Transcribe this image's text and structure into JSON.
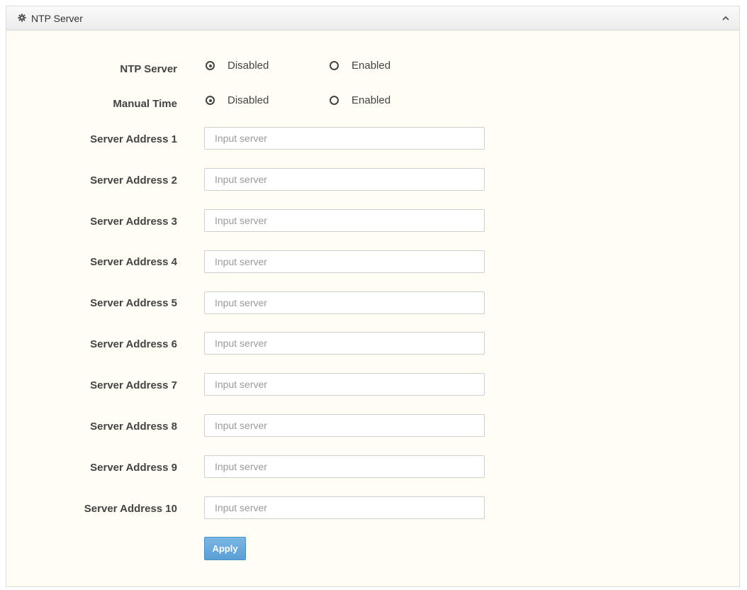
{
  "panel": {
    "title": "NTP Server",
    "header_icon": "gear-icon",
    "collapse_icon": "chevron-up-icon"
  },
  "ntp_server": {
    "label": "NTP Server",
    "options": [
      {
        "label": "Disabled",
        "checked": true
      },
      {
        "label": "Enabled",
        "checked": false
      }
    ]
  },
  "manual_time": {
    "label": "Manual Time",
    "options": [
      {
        "label": "Disabled",
        "checked": true
      },
      {
        "label": "Enabled",
        "checked": false
      }
    ]
  },
  "servers": [
    {
      "label": "Server Address 1",
      "value": "",
      "placeholder": "Input server"
    },
    {
      "label": "Server Address 2",
      "value": "",
      "placeholder": "Input server"
    },
    {
      "label": "Server Address 3",
      "value": "",
      "placeholder": "Input server"
    },
    {
      "label": "Server Address 4",
      "value": "",
      "placeholder": "Input server"
    },
    {
      "label": "Server Address 5",
      "value": "",
      "placeholder": "Input server"
    },
    {
      "label": "Server Address 6",
      "value": "",
      "placeholder": "Input server"
    },
    {
      "label": "Server Address 7",
      "value": "",
      "placeholder": "Input server"
    },
    {
      "label": "Server Address 8",
      "value": "",
      "placeholder": "Input server"
    },
    {
      "label": "Server Address 9",
      "value": "",
      "placeholder": "Input server"
    },
    {
      "label": "Server Address 10",
      "value": "",
      "placeholder": "Input server"
    }
  ],
  "apply_label": "Apply"
}
